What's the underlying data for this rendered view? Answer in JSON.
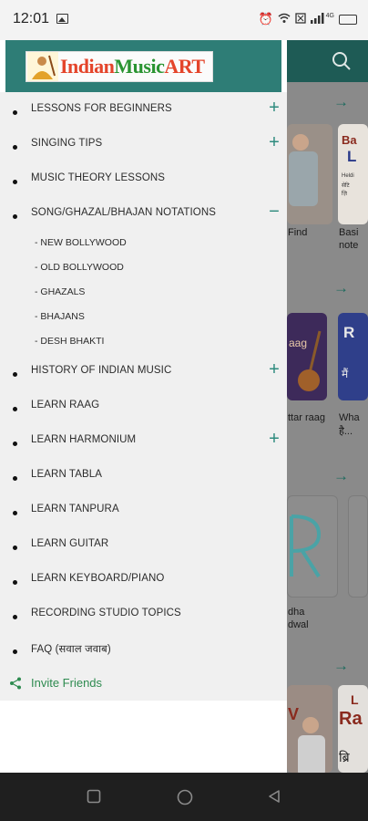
{
  "status_bar": {
    "time": "12:01",
    "network": "4G"
  },
  "app_header": {
    "logo_text_left": "Indian",
    "logo_text_mid": "Music",
    "logo_text_right": "ART"
  },
  "menu": {
    "items": [
      {
        "label": "LESSONS FOR BEGINNERS",
        "expand": "+"
      },
      {
        "label": "SINGING TIPS",
        "expand": "+"
      },
      {
        "label": "MUSIC THEORY LESSONS",
        "expand": ""
      },
      {
        "label": "SONG/GHAZAL/BHAJAN NOTATIONS",
        "expand": "−"
      },
      {
        "label": "HISTORY OF INDIAN MUSIC",
        "expand": "+"
      },
      {
        "label": "LEARN RAAG",
        "expand": ""
      },
      {
        "label": "LEARN HARMONIUM",
        "expand": "+"
      },
      {
        "label": "LEARN TABLA",
        "expand": ""
      },
      {
        "label": "LEARN TANPURA",
        "expand": ""
      },
      {
        "label": "LEARN GUITAR",
        "expand": ""
      },
      {
        "label": "LEARN KEYBOARD/PIANO",
        "expand": ""
      },
      {
        "label": "RECORDING STUDIO TOPICS",
        "expand": ""
      },
      {
        "label": "FAQ (सवाल जवाब)",
        "expand": ""
      }
    ],
    "subitems": [
      {
        "label": "- NEW BOLLYWOOD"
      },
      {
        "label": "- OLD BOLLYWOOD"
      },
      {
        "label": "- GHAZALS"
      },
      {
        "label": "- BHAJANS"
      },
      {
        "label": "- DESH BHAKTI"
      }
    ],
    "invite_label": "Invite Friends"
  },
  "background": {
    "card1_title": "Find",
    "card2_title_a": "Basi",
    "card2_title_b": "note",
    "card3_title": "ttar raag",
    "card4_title_a": "Wha",
    "card4_title_b": "है...",
    "card5_title_a": "dha",
    "card5_title_b": "dwal",
    "card2_thumb_a": "Ba",
    "card2_thumb_b": "L",
    "card2_thumb_c": "Heldi",
    "card2_thumb_d": "सेटि",
    "card2_thumb_e": "ज़ि",
    "card3_thumb": "aag",
    "card4_thumb_a": "R",
    "card4_thumb_b": "मैं",
    "card6_thumb_a": "L",
    "card6_thumb_b": "Ra",
    "card6_thumb_c": "ब्रि",
    "card6_thumb_d": "V"
  },
  "colors": {
    "primary": "#2e7d76",
    "accent": "#2e8b7e",
    "invite": "#2e8b50"
  }
}
